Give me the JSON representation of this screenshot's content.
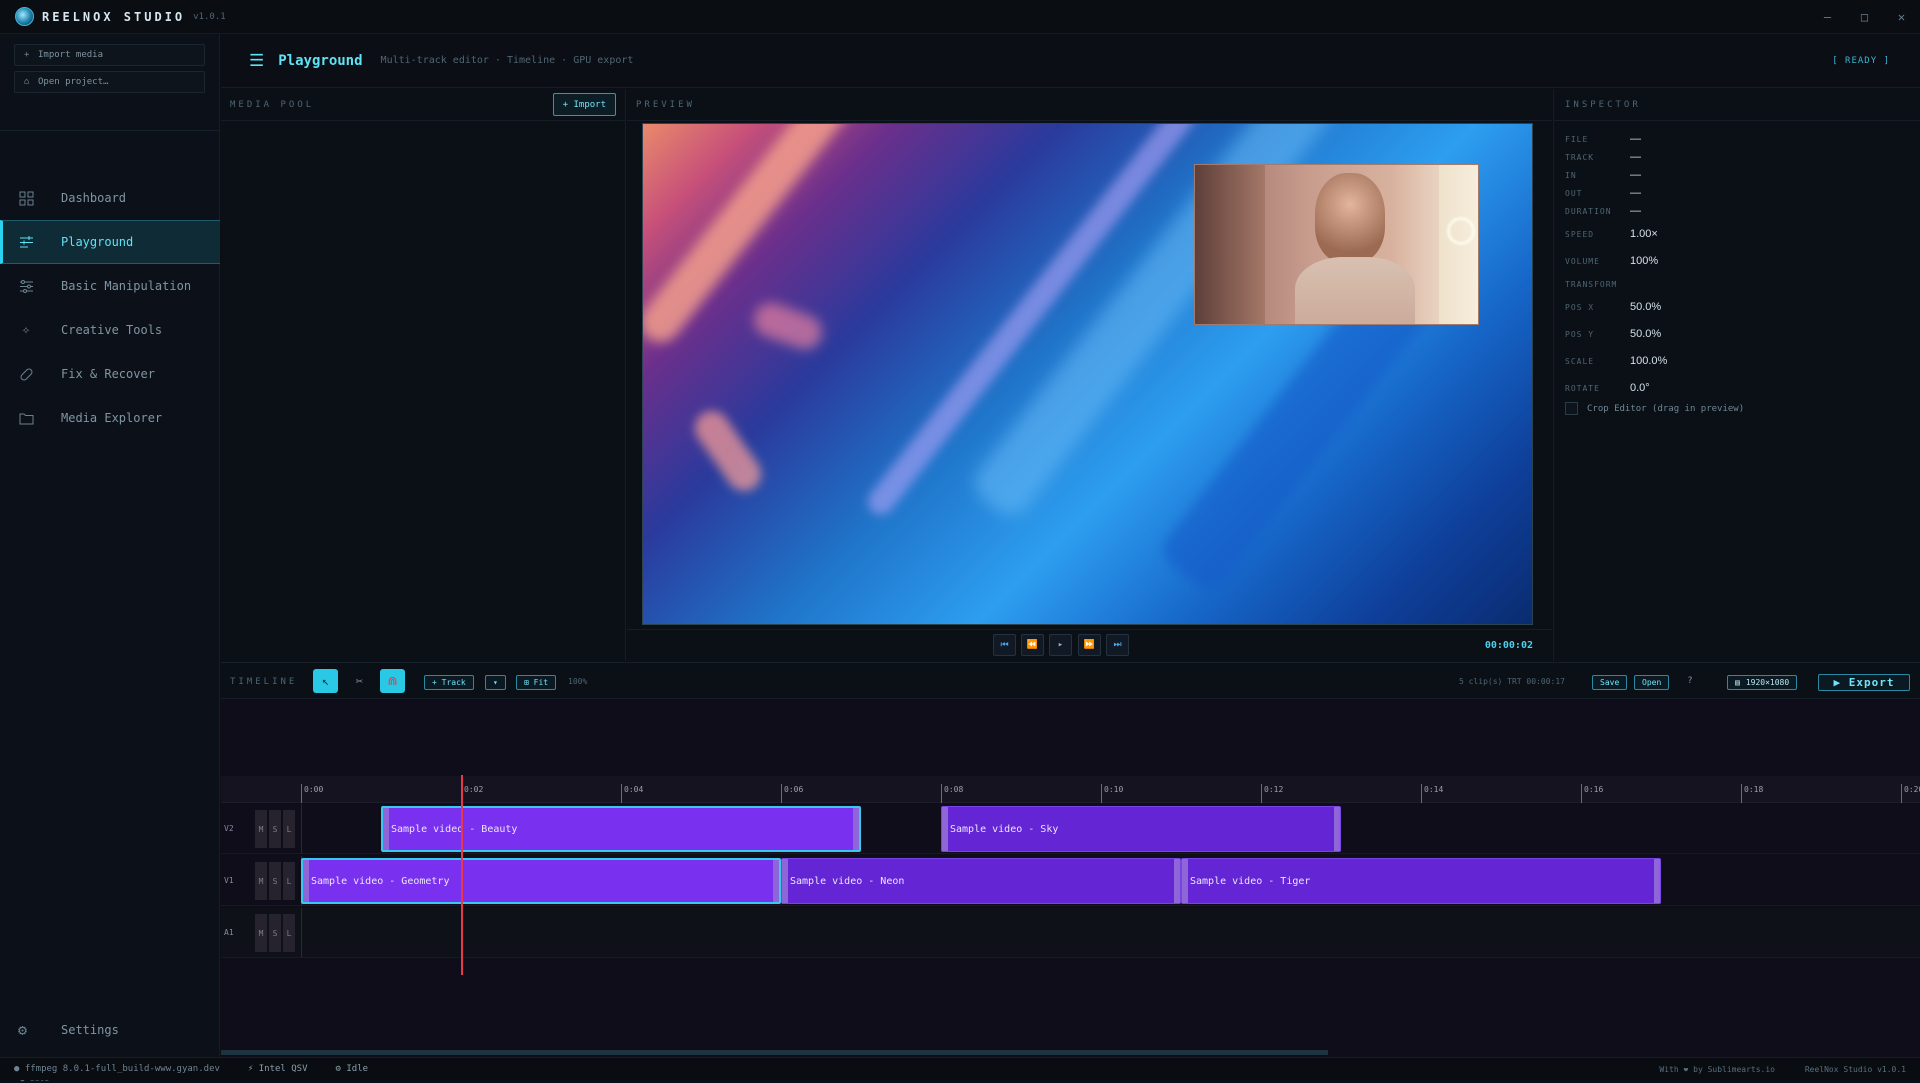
{
  "app": {
    "name": "REELNOX STUDIO",
    "version": "v1.0.1"
  },
  "window_controls": {
    "minimize": "—",
    "maximize": "□",
    "close": "✕"
  },
  "sidebar": {
    "import_media": "Import media",
    "open_project": "Open project…",
    "items": [
      {
        "label": "Dashboard",
        "icon": "dashboard-icon"
      },
      {
        "label": "Playground",
        "icon": "sliders-icon",
        "active": true
      },
      {
        "label": "Basic Manipulation",
        "icon": "adjust-icon"
      },
      {
        "label": "Creative Tools",
        "icon": "sparkle-icon"
      },
      {
        "label": "Fix & Recover",
        "icon": "bandage-icon"
      },
      {
        "label": "Media Explorer",
        "icon": "folder-icon"
      }
    ],
    "settings": "Settings",
    "status": "● idle"
  },
  "header": {
    "title": "Playground",
    "subtitle": "Multi-track editor · Timeline · GPU export",
    "status": "[ READY ]"
  },
  "media_pool": {
    "label": "MEDIA POOL",
    "import_button": "+ Import"
  },
  "preview": {
    "label": "PREVIEW",
    "timecode": "00:00:02"
  },
  "inspector": {
    "label": "INSPECTOR",
    "fields": [
      {
        "key": "FILE",
        "value": "—"
      },
      {
        "key": "TRACK",
        "value": "—"
      },
      {
        "key": "IN",
        "value": "—"
      },
      {
        "key": "OUT",
        "value": "—"
      },
      {
        "key": "DURATION",
        "value": "—"
      },
      {
        "key": "SPEED",
        "value": "1.00×"
      },
      {
        "key": "VOLUME",
        "value": "100%"
      },
      {
        "key": "TRANSFORM",
        "value": ""
      },
      {
        "key": "POS X",
        "value": "50.0%"
      },
      {
        "key": "POS Y",
        "value": "50.0%"
      },
      {
        "key": "SCALE",
        "value": "100.0%"
      },
      {
        "key": "ROTATE",
        "value": "0.0°"
      }
    ],
    "crop_label": "Crop Editor (drag in preview)"
  },
  "timeline": {
    "label": "TIMELINE",
    "add_track": "+ Track",
    "fit": "⊞ Fit",
    "zoom": "100%",
    "info": "5 clip(s)  TRT 00:00:17",
    "save": "Save",
    "open": "Open",
    "help": "?",
    "resolution": "1920×1080",
    "export": "▶ Export",
    "ruler": [
      "0:00",
      "0:02",
      "0:04",
      "0:06",
      "0:08",
      "0:10",
      "0:12",
      "0:14",
      "0:16",
      "0:18",
      "0:20"
    ],
    "tracks": [
      {
        "name": "V2",
        "clips": [
          {
            "label": "Sample video -  Beauty",
            "start_s": 1.0,
            "end_s": 7.0,
            "selected": true
          },
          {
            "label": "Sample video - Sky",
            "start_s": 8.0,
            "end_s": 13.0,
            "selected": false
          }
        ]
      },
      {
        "name": "V1",
        "clips": [
          {
            "label": "Sample video - Geometry",
            "start_s": 0.0,
            "end_s": 6.0,
            "selected": true
          },
          {
            "label": "Sample video - Neon",
            "start_s": 6.0,
            "end_s": 11.0,
            "selected": false
          },
          {
            "label": "Sample video - Tiger",
            "start_s": 11.0,
            "end_s": 17.0,
            "selected": false
          }
        ]
      },
      {
        "name": "A1",
        "clips": []
      }
    ],
    "track_buttons": [
      "M",
      "S",
      "L"
    ],
    "playhead_s": 2.0
  },
  "statusbar": {
    "ffmpeg": "● ffmpeg 8.0.1-full_build-www.gyan.dev",
    "hw": "⚡ Intel QSV",
    "state": "⚙ Idle",
    "credit": "With ❤ by Sublimearts.io",
    "version": "ReelNox Studio v1.0.1"
  },
  "colors": {
    "accent": "#2ad4f0",
    "clip": "#6425d4",
    "clip_selected": "#7a30ef",
    "playhead": "#e8384a"
  }
}
